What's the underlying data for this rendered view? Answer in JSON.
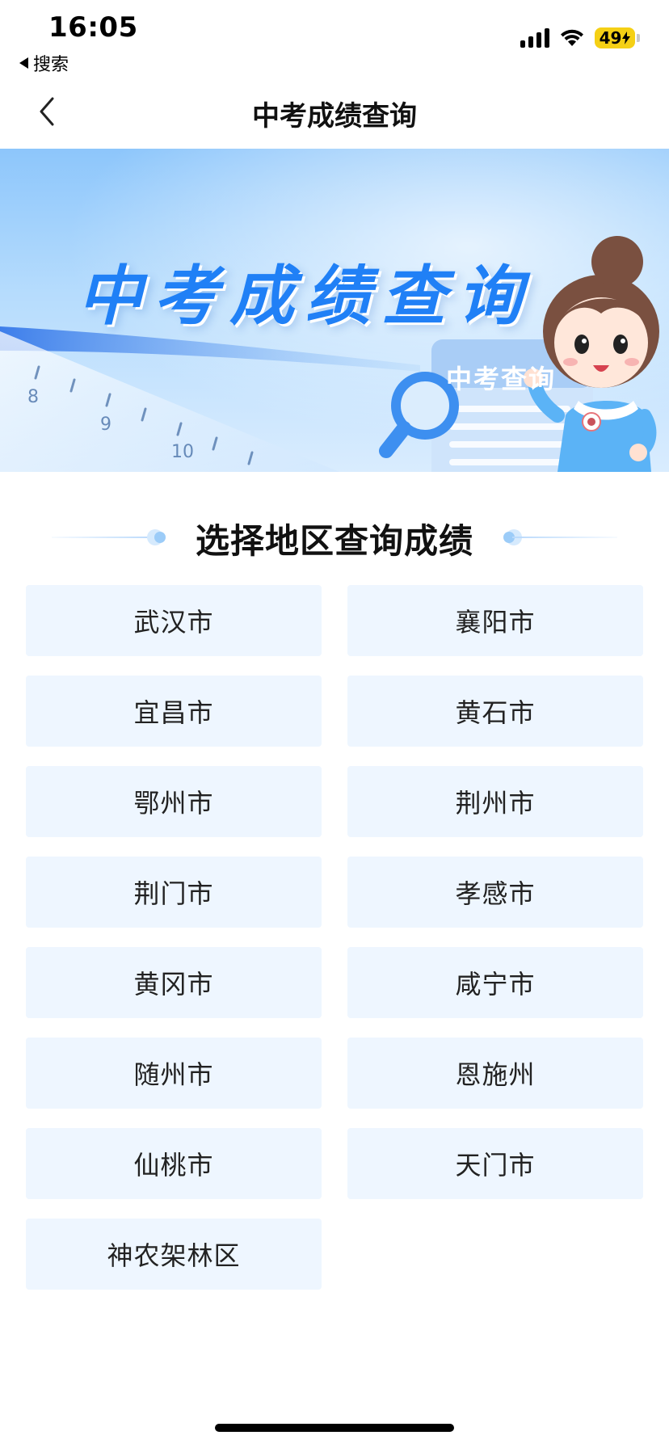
{
  "status_bar": {
    "time": "16:05",
    "back_label": "搜索",
    "battery": "49"
  },
  "nav": {
    "title": "中考成绩查询"
  },
  "banner": {
    "title": "中考成绩查询",
    "card_text": "中考查询"
  },
  "section": {
    "title": "选择地区查询成绩"
  },
  "cities": [
    "武汉市",
    "襄阳市",
    "宜昌市",
    "黄石市",
    "鄂州市",
    "荆州市",
    "荆门市",
    "孝感市",
    "黄冈市",
    "咸宁市",
    "随州市",
    "恩施州",
    "仙桃市",
    "天门市",
    "神农架林区"
  ],
  "colors": {
    "accent": "#2080f6",
    "button_bg": "#eef6ff",
    "battery": "#f5d015"
  }
}
